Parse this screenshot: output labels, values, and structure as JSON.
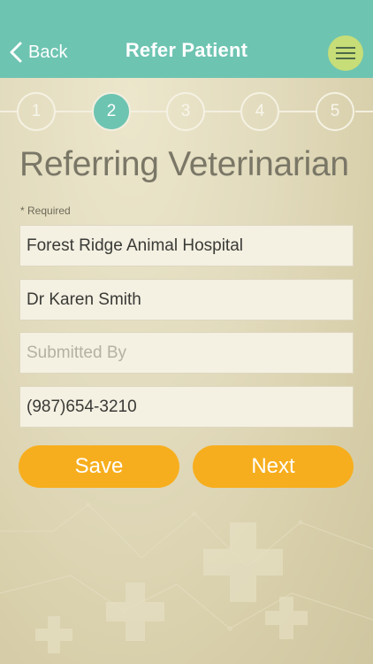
{
  "header": {
    "back_label": "Back",
    "title": "Refer Patient",
    "menu_icon": "hamburger-menu-icon",
    "back_icon": "chevron-left-icon"
  },
  "steps": {
    "items": [
      "1",
      "2",
      "3",
      "4",
      "5"
    ],
    "active": "2"
  },
  "form": {
    "section_title": "Referring Veterinarian",
    "required_note": "* Required",
    "clinic_value": "Forest Ridge Animal Hospital",
    "vet_value": "Dr Karen Smith",
    "submitted_by_placeholder": "Submitted By",
    "phone_value": "(987)654-3210"
  },
  "buttons": {
    "save_label": "Save",
    "next_label": "Next"
  },
  "colors": {
    "header": "#6dc4b1",
    "menu_button": "#c6dd78",
    "action_button": "#f7ae1e",
    "background": "#e2dbbd"
  }
}
